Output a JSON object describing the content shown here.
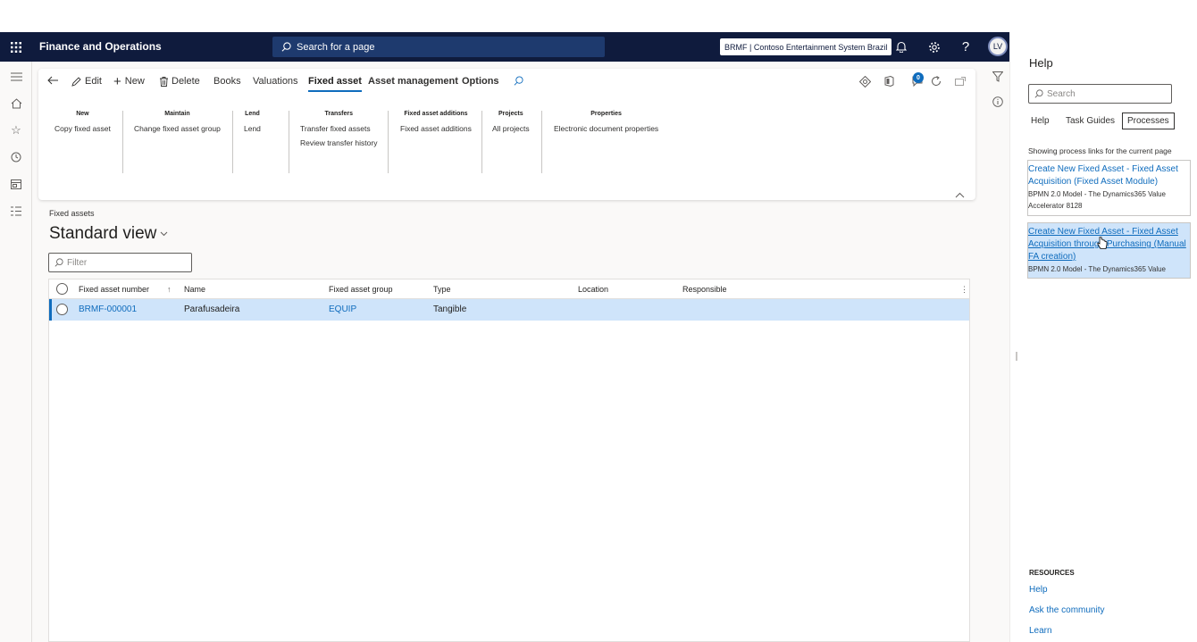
{
  "navbar": {
    "app_name": "Finance and Operations",
    "search_placeholder": "Search for a page",
    "company": "BRMF | Contoso Entertainment System Brazil",
    "avatar_initials": "LV"
  },
  "tabs": {
    "edit": "Edit",
    "new": "New",
    "delete": "Delete",
    "books": "Books",
    "valuations": "Valuations",
    "fixed_asset": "Fixed asset",
    "asset_management": "Asset management",
    "options": "Options",
    "notification_count": "0"
  },
  "groups": {
    "new": {
      "title": "New",
      "items": [
        "Copy fixed asset"
      ]
    },
    "maintain": {
      "title": "Maintain",
      "items": [
        "Change fixed asset group"
      ]
    },
    "lend": {
      "title": "Lend",
      "items": [
        "Lend"
      ]
    },
    "transfers": {
      "title": "Transfers",
      "items": [
        "Transfer fixed assets",
        "Review transfer history"
      ]
    },
    "additions": {
      "title": "Fixed asset additions",
      "items": [
        "Fixed asset additions"
      ]
    },
    "projects": {
      "title": "Projects",
      "items": [
        "All projects"
      ]
    },
    "properties": {
      "title": "Properties",
      "items": [
        "Electronic document properties"
      ]
    }
  },
  "page": {
    "breadcrumb": "Fixed assets",
    "view_title": "Standard view",
    "filter_placeholder": "Filter"
  },
  "grid": {
    "columns": [
      "Fixed asset number",
      "Name",
      "Fixed asset group",
      "Type",
      "Location",
      "Responsible"
    ],
    "rows": [
      {
        "number": "BRMF-000001",
        "name": "Parafusadeira",
        "group": "EQUIP",
        "type": "Tangible",
        "location": "",
        "responsible": ""
      }
    ]
  },
  "help": {
    "title": "Help",
    "search_placeholder": "Search",
    "tabs": [
      "Help",
      "Task Guides",
      "Processes"
    ],
    "selected_tab": "Processes",
    "showing": "Showing process links for the current page",
    "processes": [
      {
        "title": "Create New Fixed Asset - Fixed Asset Acquisition (Fixed Asset Module)",
        "sub": "BPMN 2.0 Model - The Dynamics365 Value Accelerator 8128"
      },
      {
        "title": "Create New Fixed Asset - Fixed Asset Acquisition through Purchasing (Manual FA creation)",
        "sub": "BPMN 2.0 Model - The Dynamics365 Value"
      }
    ],
    "resources_title": "RESOURCES",
    "resources": [
      "Help",
      "Ask the community",
      "Learn"
    ]
  },
  "colors": {
    "navbar_bg": "#0f1b3d",
    "accent": "#0f6cbd",
    "selected_row": "#cfe4fa"
  }
}
